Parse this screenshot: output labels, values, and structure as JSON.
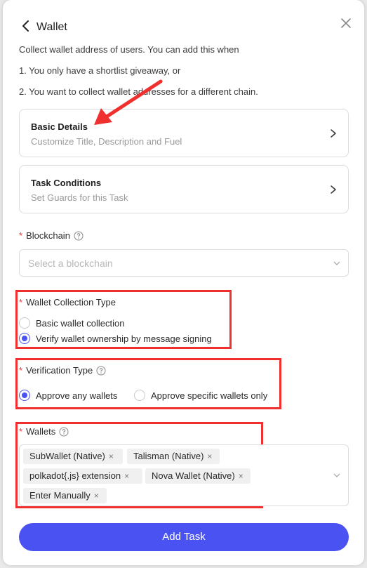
{
  "header": {
    "title": "Wallet",
    "back_icon": "arrow-left-icon",
    "close_icon": "close-icon"
  },
  "description": {
    "line1": "Collect wallet address of users. You can add this when",
    "line2": "1. You only have a shortlist giveaway, or",
    "line3": "2. You want to collect wallet addresses for a different chain."
  },
  "cards": [
    {
      "title": "Basic Details",
      "subtitle": "Customize Title, Description and Fuel"
    },
    {
      "title": "Task Conditions",
      "subtitle": "Set Guards for this Task"
    }
  ],
  "blockchain": {
    "label": "Blockchain",
    "required": "*",
    "placeholder": "Select a blockchain"
  },
  "wallet_collection": {
    "label": "Wallet Collection Type",
    "required": "*",
    "options": [
      "Basic wallet collection",
      "Verify wallet ownership by message signing"
    ],
    "selected": "Verify wallet ownership by message signing"
  },
  "verification": {
    "label": "Verification Type",
    "required": "*",
    "options": [
      "Approve any wallets",
      "Approve specific wallets only"
    ],
    "selected": "Approve any wallets"
  },
  "wallets": {
    "label": "Wallets",
    "required": "*",
    "tags": [
      "SubWallet (Native)",
      "Talisman (Native)",
      "polkadot{.js} extension",
      "Nova Wallet (Native)",
      "Enter Manually"
    ],
    "remove_glyph": "×"
  },
  "submit": {
    "label": "Add Task"
  },
  "colors": {
    "accent": "#4a53f2",
    "annotation": "#f0302f",
    "required": "#e53935"
  }
}
